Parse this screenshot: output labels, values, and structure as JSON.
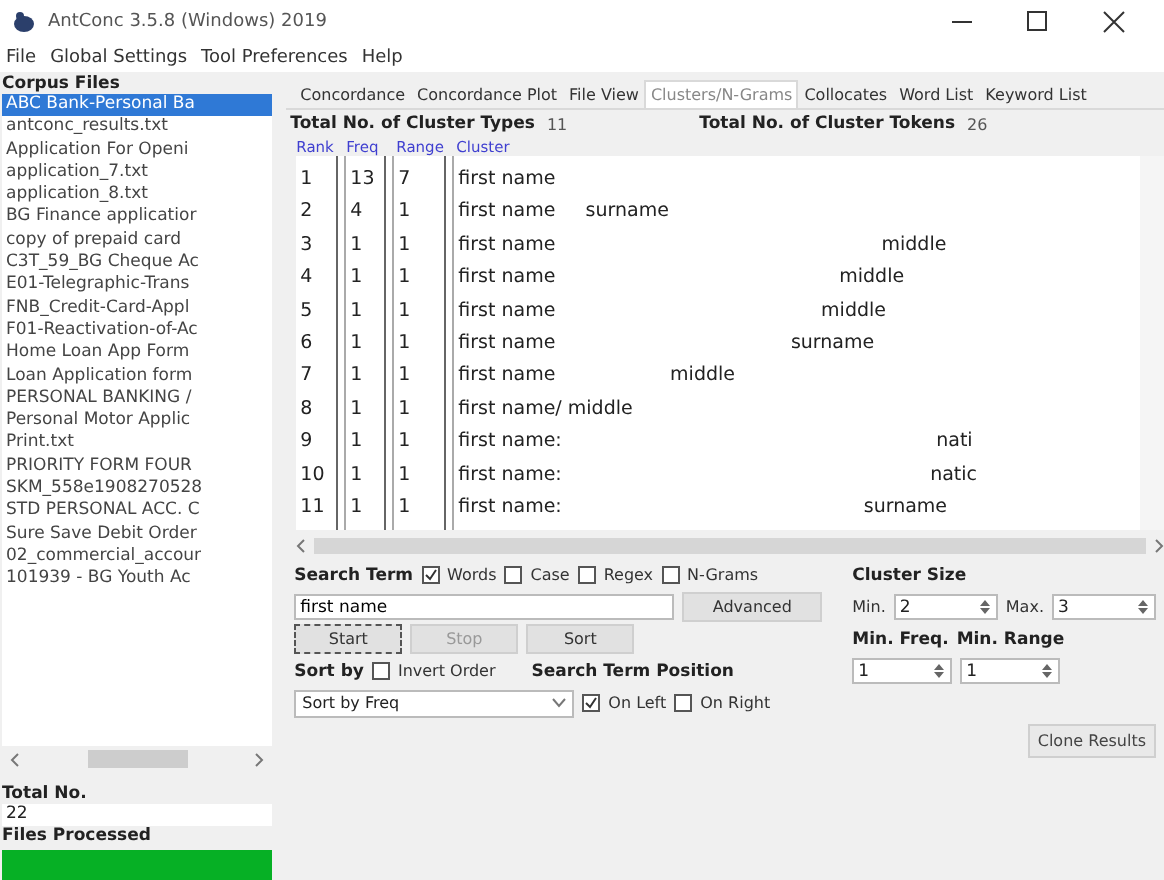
{
  "window": {
    "title": "AntConc 3.5.8 (Windows) 2019"
  },
  "menu": [
    "File",
    "Global Settings",
    "Tool Preferences",
    "Help"
  ],
  "corpus": {
    "header": "Corpus Files",
    "files": [
      {
        "name": "ABC Bank-Personal Ba",
        "selected": true
      },
      {
        "name": "antconc_results.txt",
        "selected": false
      },
      {
        "name": "Application For Openi",
        "selected": false
      },
      {
        "name": "application_7.txt",
        "selected": false
      },
      {
        "name": "application_8.txt",
        "selected": false
      },
      {
        "name": "BG Finance applicatior",
        "selected": false
      },
      {
        "name": "copy of prepaid card",
        "selected": false
      },
      {
        "name": "C3T_59_BG Cheque Ac",
        "selected": false
      },
      {
        "name": "E01-Telegraphic-Trans",
        "selected": false
      },
      {
        "name": "FNB_Credit-Card-Appl",
        "selected": false
      },
      {
        "name": "F01-Reactivation-of-Ac",
        "selected": false
      },
      {
        "name": "Home Loan App Form",
        "selected": false
      },
      {
        "name": "Loan Application form",
        "selected": false
      },
      {
        "name": "PERSONAL BANKING /",
        "selected": false
      },
      {
        "name": "Personal Motor Applic",
        "selected": false
      },
      {
        "name": "Print.txt",
        "selected": false
      },
      {
        "name": "PRIORITY FORM FOUR",
        "selected": false
      },
      {
        "name": "SKM_558e1908270528",
        "selected": false
      },
      {
        "name": "STD PERSONAL ACC. C",
        "selected": false
      },
      {
        "name": "Sure Save Debit Order",
        "selected": false
      },
      {
        "name": "02_commercial_accour",
        "selected": false
      },
      {
        "name": "101939 - BG Youth Ac",
        "selected": false
      }
    ],
    "total_label": "Total No.",
    "total": "22",
    "processed_label": "Files Processed",
    "progress": {
      "level": 1
    }
  },
  "tabs": [
    {
      "label": "Concordance",
      "selected": false
    },
    {
      "label": "Concordance Plot",
      "selected": false
    },
    {
      "label": "File View",
      "selected": false
    },
    {
      "label": "Clusters/N-Grams",
      "selected": true
    },
    {
      "label": "Collocates",
      "selected": false
    },
    {
      "label": "Word List",
      "selected": false
    },
    {
      "label": "Keyword List",
      "selected": false
    }
  ],
  "totals": {
    "types_label": "Total No. of Cluster Types",
    "types": "11",
    "tokens_label": "Total No. of Cluster Tokens",
    "tokens": "26"
  },
  "table": {
    "columns": [
      "Rank",
      "Freq",
      "Range",
      "Cluster"
    ],
    "rows": [
      [
        "1",
        "13",
        "7",
        "first name"
      ],
      [
        "2",
        "4",
        "1",
        "first name     surname"
      ],
      [
        "3",
        "1",
        "1",
        "first name                                                      middle"
      ],
      [
        "4",
        "1",
        "1",
        "first name                                               middle"
      ],
      [
        "5",
        "1",
        "1",
        "first name                                            middle"
      ],
      [
        "6",
        "1",
        "1",
        "first name                                       surname"
      ],
      [
        "7",
        "1",
        "1",
        "first name                   middle"
      ],
      [
        "8",
        "1",
        "1",
        "first name/ middle"
      ],
      [
        "9",
        "1",
        "1",
        "first name:                                                              nati"
      ],
      [
        "10",
        "1",
        "1",
        "first name:                                                             natic"
      ],
      [
        "11",
        "1",
        "1",
        "first name:                                                  surname"
      ]
    ]
  },
  "search": {
    "label": "Search Term",
    "options": [
      {
        "label": "Words",
        "checked": true
      },
      {
        "label": "Case",
        "checked": false
      },
      {
        "label": "Regex",
        "checked": false
      },
      {
        "label": "N-Grams",
        "checked": false
      }
    ],
    "value": "first name",
    "advanced": "Advanced",
    "start": "Start",
    "stop": {
      "label": "Stop",
      "disabled": true
    },
    "sort": "Sort"
  },
  "sort_by": {
    "label": "Sort by",
    "invert": {
      "label": "Invert Order",
      "checked": false
    },
    "value": "Sort by Freq"
  },
  "position": {
    "label": "Search Term Position",
    "options": [
      {
        "label": "On Left",
        "checked": true
      },
      {
        "label": "On Right",
        "checked": false
      }
    ]
  },
  "cluster_size": {
    "label": "Cluster Size",
    "min_label": "Min.",
    "min": "2",
    "max_label": "Max.",
    "max": "3"
  },
  "min_freq": {
    "label": "Min. Freq.",
    "value": "1"
  },
  "min_range": {
    "label": "Min. Range",
    "value": "1"
  },
  "clone": "Clone Results"
}
